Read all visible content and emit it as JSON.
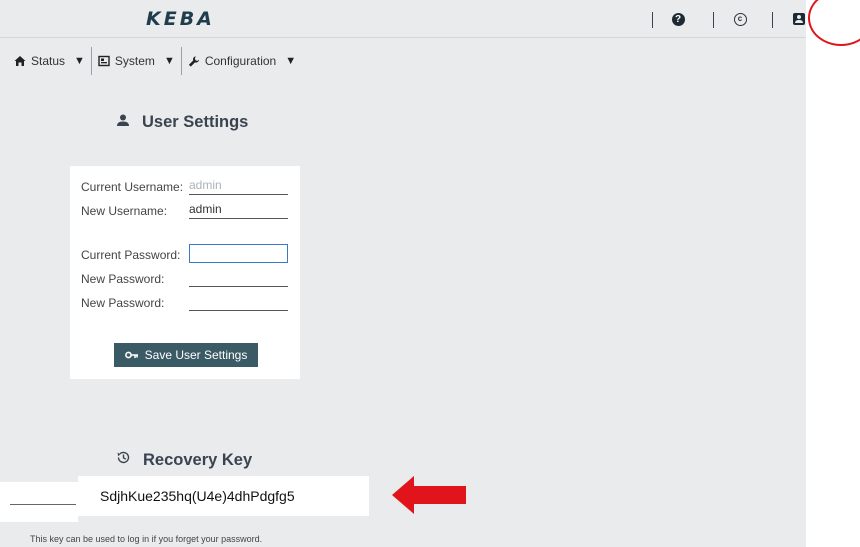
{
  "header": {
    "logo_text": "KEBA",
    "icons": [
      "help-icon",
      "copyright-icon",
      "user-account-icon"
    ]
  },
  "nav": {
    "items": [
      {
        "label": "Status",
        "icon": "home-icon"
      },
      {
        "label": "System",
        "icon": "system-icon"
      },
      {
        "label": "Configuration",
        "icon": "wrench-icon"
      }
    ],
    "caret": "▼"
  },
  "user_settings": {
    "title": "User Settings",
    "current_username_label": "Current Username:",
    "current_username_value": "admin",
    "new_username_label": "New Username:",
    "new_username_value": "admin",
    "current_password_label": "Current Password:",
    "new_password_label": "New Password:",
    "new_password_repeat_label": "New Password:",
    "save_label": "Save User Settings"
  },
  "recovery": {
    "title": "Recovery Key",
    "key": "SdjhKue235hq(U4e)4dhPdgfg5",
    "hint": "This key can be used to log in if you forget your password."
  },
  "colors": {
    "background": "#e9ebed",
    "button": "#3a5a66",
    "annotation": "#e0141a",
    "focus_border": "#3a78c8"
  }
}
